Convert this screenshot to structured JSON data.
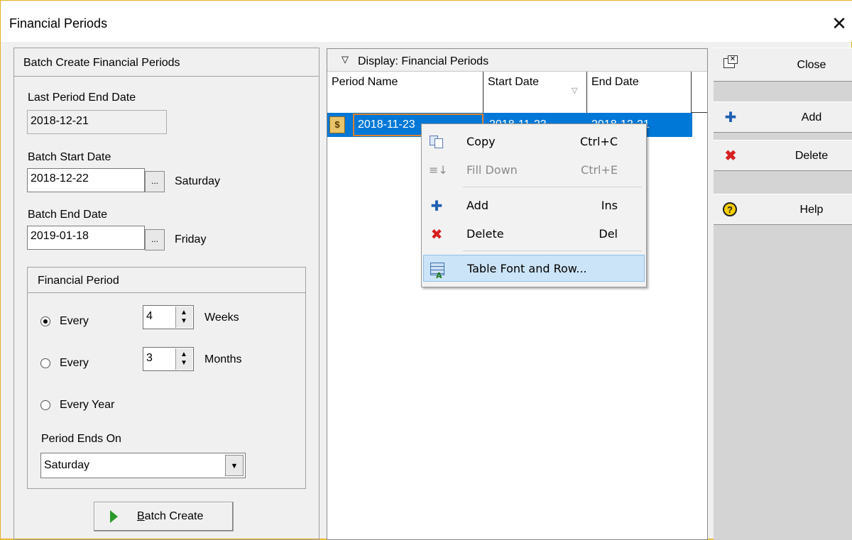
{
  "window": {
    "title": "Financial Periods"
  },
  "batch": {
    "header": "Batch Create Financial Periods",
    "last_end_label": "Last Period End Date",
    "last_end_value": "2018-12-21",
    "start_label": "Batch Start Date",
    "start_value": "2018-12-22",
    "start_day": "Saturday",
    "end_label": "Batch End Date",
    "end_value": "2019-01-18",
    "end_day": "Friday",
    "browse_label": "...",
    "create_button": "Batch Create",
    "create_underline": "B",
    "create_rest": "atch Create"
  },
  "period": {
    "header": "Financial Period",
    "every_label": "Every",
    "weeks_value": "4",
    "weeks_label": "Weeks",
    "months_value": "3",
    "months_label": "Months",
    "every_year_label": "Every Year",
    "selected": "weeks",
    "ends_on_label": "Period Ends On",
    "ends_on_value": "Saturday"
  },
  "grid": {
    "display_label": "Display: Financial Periods",
    "columns": [
      "Period Name",
      "Start Date",
      "End Date"
    ],
    "row": {
      "period_name": "2018-11-23",
      "start_date": "2018-11-23",
      "end_date": "2018-12-21"
    }
  },
  "context_menu": [
    {
      "label": "Copy",
      "shortcut": "Ctrl+C",
      "icon": "copy-icon",
      "disabled": false
    },
    {
      "label": "Fill Down",
      "shortcut": "Ctrl+E",
      "icon": "fill-down-icon",
      "disabled": true
    },
    {
      "label": "Add",
      "shortcut": "Ins",
      "icon": "add-icon",
      "disabled": false
    },
    {
      "label": "Delete",
      "shortcut": "Del",
      "icon": "delete-icon",
      "disabled": false
    },
    {
      "label": "Table Font and Row...",
      "shortcut": "",
      "icon": "table-font-icon",
      "disabled": false,
      "highlighted": true
    }
  ],
  "toolbar": {
    "close": "Close",
    "add": "Add",
    "delete": "Delete",
    "help": "Help"
  },
  "colors": {
    "selection": "#0078d7",
    "menu_highlight": "#cce4f7",
    "delete_red": "#d62020",
    "play_green": "#2a9a2a",
    "help_yellow": "#f5d000"
  }
}
